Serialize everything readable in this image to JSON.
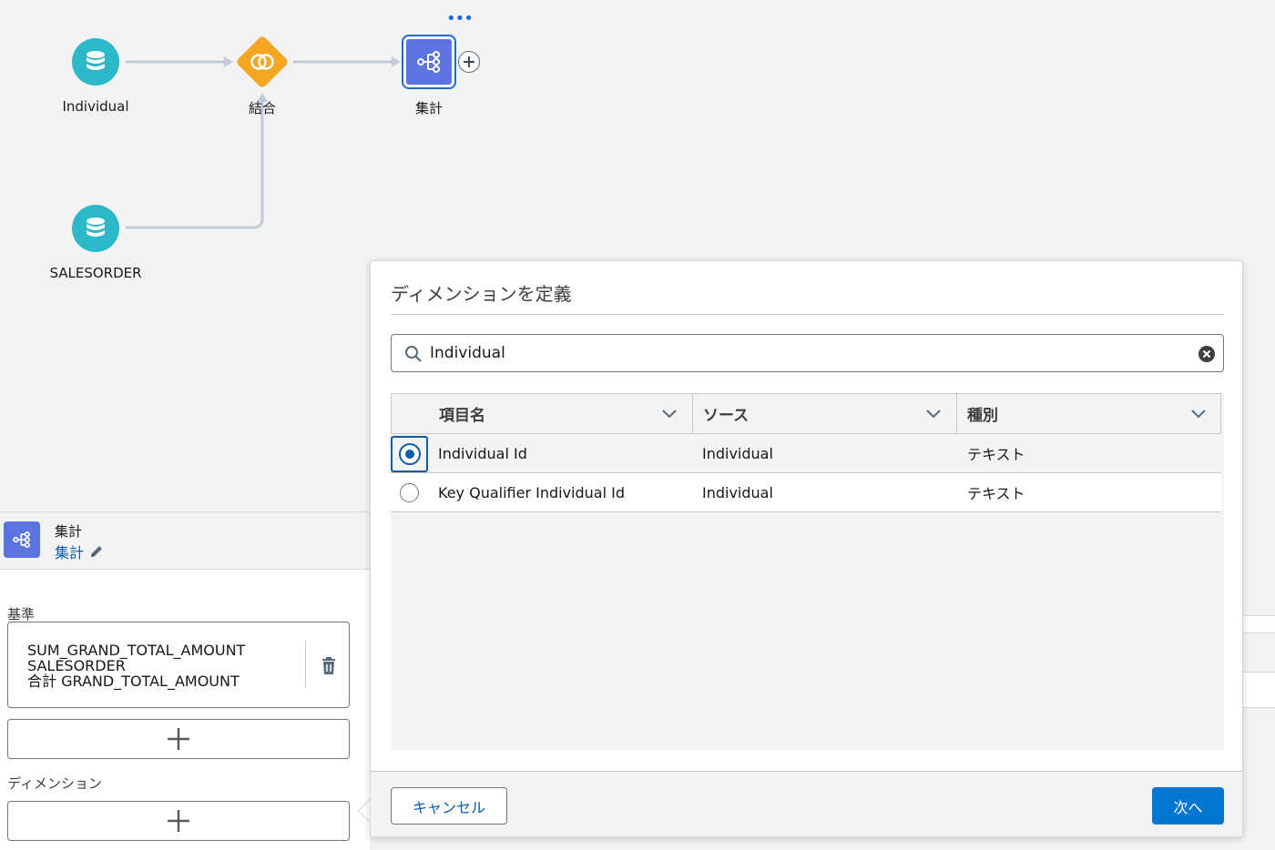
{
  "flow": {
    "nodes": [
      {
        "label": "Individual",
        "icon": "database-icon"
      },
      {
        "label": "結合",
        "icon": "join-icon"
      },
      {
        "label": "集計",
        "icon": "aggregate-icon"
      },
      {
        "label": "SALESORDER",
        "icon": "database-icon"
      }
    ],
    "more_label": "•••",
    "add_icon": "plus-icon"
  },
  "panel": {
    "node_type": "集計",
    "node_name": "集計",
    "measures_label": "基準",
    "measure": {
      "line1": "SUM_GRAND_TOTAL_AMOUNT",
      "line2": "SALESORDER",
      "line3": "合計 GRAND_TOTAL_AMOUNT"
    },
    "dimensions_label": "ディメンション"
  },
  "modal": {
    "title": "ディメンションを定義",
    "search": {
      "value": "Individual",
      "placeholder": ""
    },
    "columns": [
      "項目名",
      "ソース",
      "種別"
    ],
    "rows": [
      {
        "name": "Individual Id",
        "source": "Individual",
        "type": "テキスト",
        "selected": true
      },
      {
        "name": "Key Qualifier Individual Id",
        "source": "Individual",
        "type": "テキスト",
        "selected": false
      }
    ],
    "cancel_label": "キャンセル",
    "next_label": "次へ"
  },
  "colors": {
    "teal_node": "#2cb8c8",
    "join_orange": "#f5a623",
    "aggregate_blue": "#5c74e0",
    "brand_blue": "#0176d3",
    "link_blue": "#0b5cab"
  }
}
